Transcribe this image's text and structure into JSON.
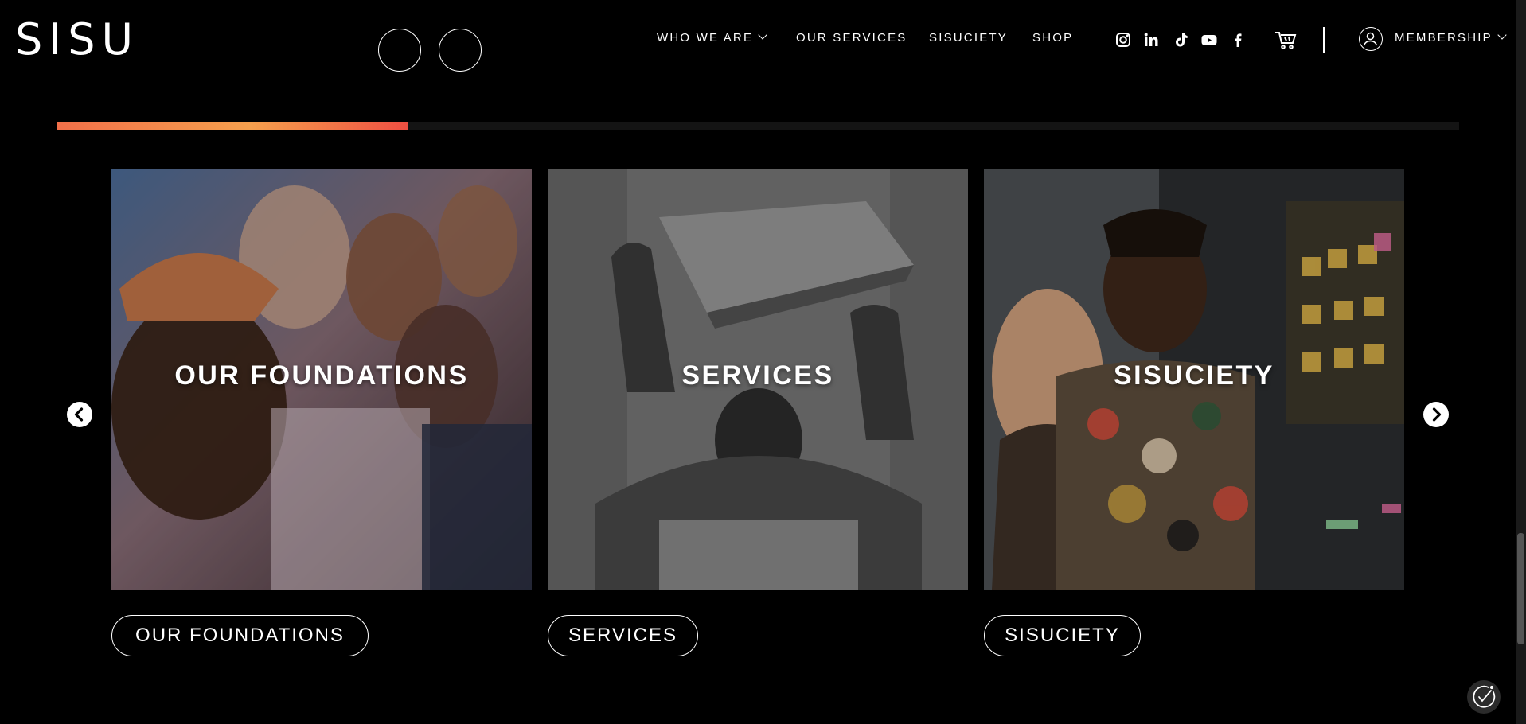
{
  "header": {
    "logo": "SISU",
    "nav": [
      {
        "label": "WHO WE ARE",
        "has_dropdown": true
      },
      {
        "label": "OUR SERVICES",
        "has_dropdown": false
      },
      {
        "label": "SISUCIETY",
        "has_dropdown": false
      },
      {
        "label": "SHOP",
        "has_dropdown": false
      }
    ],
    "social_icons": [
      "instagram-icon",
      "linkedin-icon",
      "tiktok-icon",
      "youtube-icon",
      "facebook-icon"
    ],
    "cart_icon": "cart-icon",
    "membership_label": "MEMBERSHIP"
  },
  "carousel": {
    "progress_fraction": 0.25,
    "progress_colors": [
      "#f2704a",
      "#f6a04d",
      "#ef4f42"
    ],
    "cards": [
      {
        "title": "OUR FOUNDATIONS",
        "button": "OUR FOUNDATIONS"
      },
      {
        "title": "SERVICES",
        "button": "SERVICES"
      },
      {
        "title": "SISUCIETY",
        "button": "SISUCIETY"
      }
    ],
    "prev_icon": "chevron-left-icon",
    "next_icon": "chevron-right-icon"
  },
  "accessibility_icon": "accessibility-icon"
}
